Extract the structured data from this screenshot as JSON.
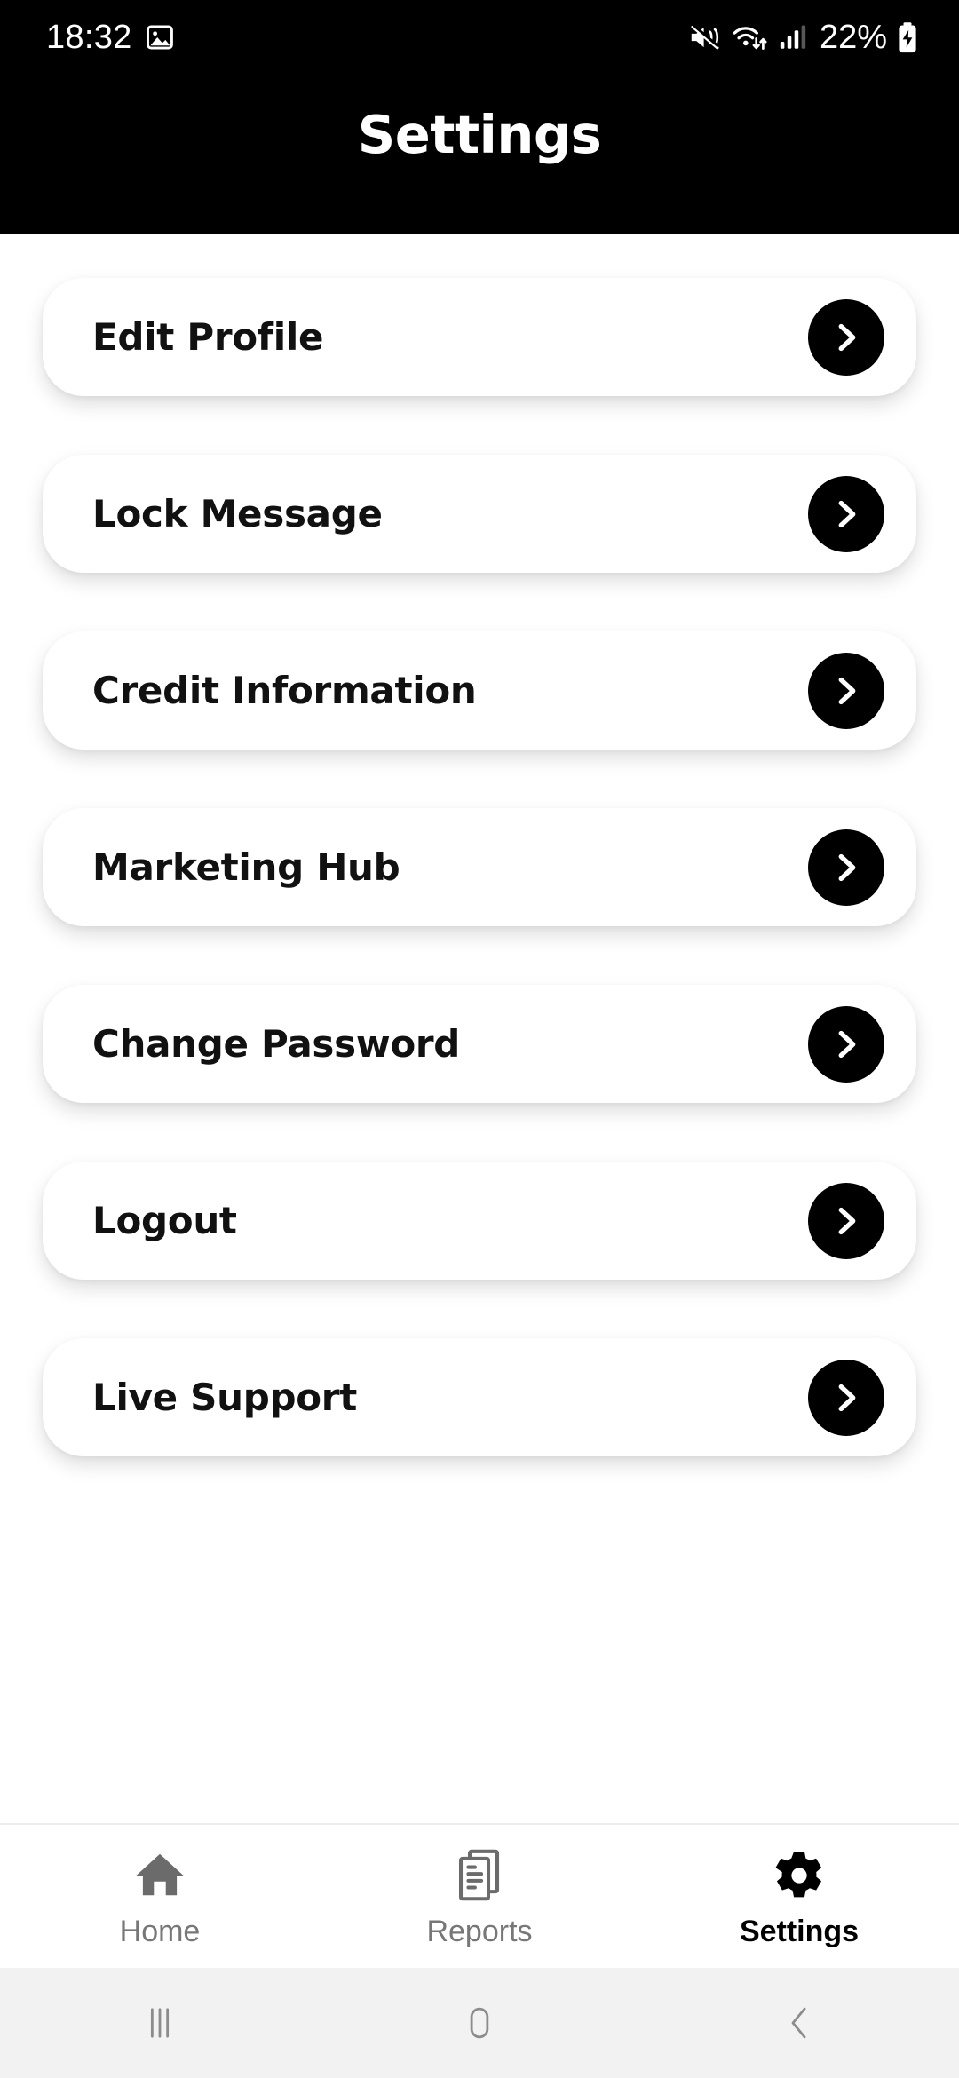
{
  "statusbar": {
    "time": "18:32",
    "battery_text": "22%",
    "icons": {
      "photo": "photo-icon",
      "mute": "mute-vibrate-icon",
      "wifi": "wifi-data-icon",
      "signal": "cellular-signal-icon",
      "battery": "battery-charging-icon"
    }
  },
  "header": {
    "title": "Settings",
    "background": "#000000",
    "text_color": "#ffffff"
  },
  "theme": {
    "page_background": "#ffffff",
    "card_background": "#ffffff",
    "accent": "#000000",
    "muted_text": "#777777",
    "sysnav_background": "#f2f2f2"
  },
  "menu": {
    "items": [
      {
        "label": "Edit Profile",
        "chevron": "chevron-right-icon"
      },
      {
        "label": "Lock Message",
        "chevron": "chevron-right-icon"
      },
      {
        "label": "Credit Information",
        "chevron": "chevron-right-icon"
      },
      {
        "label": "Marketing Hub",
        "chevron": "chevron-right-icon"
      },
      {
        "label": "Change Password",
        "chevron": "chevron-right-icon"
      },
      {
        "label": "Logout",
        "chevron": "chevron-right-icon"
      },
      {
        "label": "Live Support",
        "chevron": "chevron-right-icon"
      }
    ]
  },
  "tabbar": {
    "tabs": [
      {
        "label": "Home",
        "icon": "home-icon",
        "active": false
      },
      {
        "label": "Reports",
        "icon": "reports-icon",
        "active": false
      },
      {
        "label": "Settings",
        "icon": "gear-icon",
        "active": true
      }
    ]
  },
  "sysnav": {
    "buttons": [
      {
        "name": "recents-button"
      },
      {
        "name": "home-button"
      },
      {
        "name": "back-button"
      }
    ]
  }
}
